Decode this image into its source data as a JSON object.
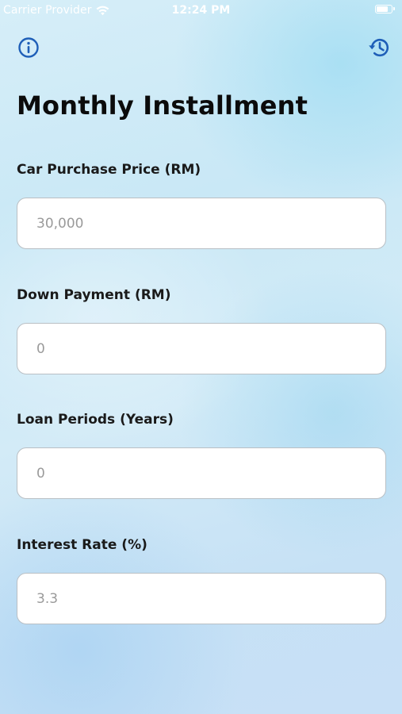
{
  "status_bar": {
    "carrier": "Carrier Provider",
    "time": "12:24 PM",
    "text_color": "#ffffff",
    "battery_level_percent": 80
  },
  "header": {
    "info_icon": "info-circle-icon",
    "history_icon": "history-icon",
    "icon_color": "#1f5fb8"
  },
  "page": {
    "title": "Monthly Installment"
  },
  "form": {
    "fields": [
      {
        "label": "Car Purchase Price (RM)",
        "placeholder": "30,000",
        "value": ""
      },
      {
        "label": "Down Payment (RM)",
        "placeholder": "0",
        "value": ""
      },
      {
        "label": "Loan Periods (Years)",
        "placeholder": "0",
        "value": ""
      },
      {
        "label": "Interest Rate (%)",
        "placeholder": "3.3",
        "value": ""
      }
    ]
  },
  "colors": {
    "background_top": "#d6eef8",
    "background_bottom": "#c8e0f6",
    "title_text": "#0b0b0b",
    "input_background": "#ffffff",
    "input_border": "#b9bfc4",
    "placeholder_text": "#9a9a9a"
  }
}
